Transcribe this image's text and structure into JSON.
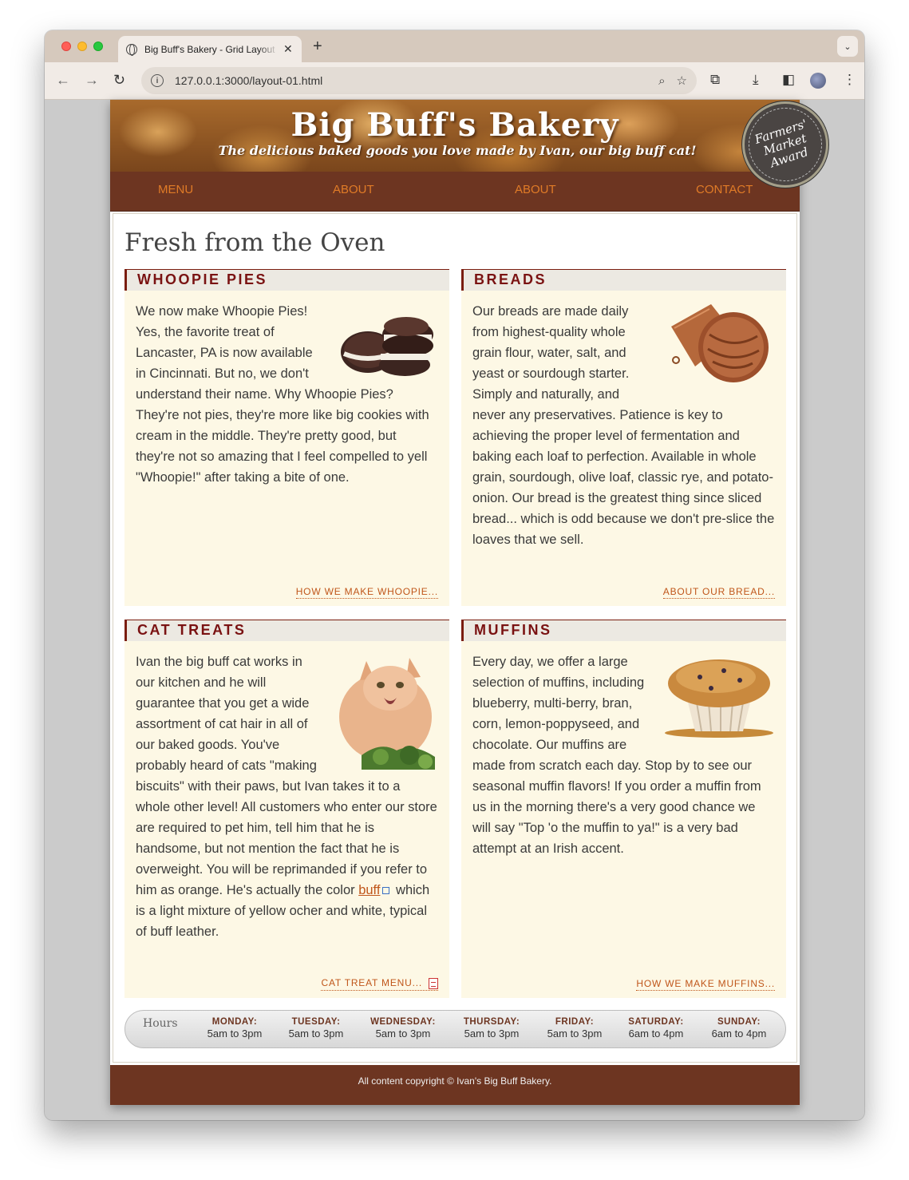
{
  "browser": {
    "tab_title": "Big Buff's Bakery - Grid Layout",
    "url": "127.0.0.1:3000/layout-01.html"
  },
  "site": {
    "title": "Big Buff's Bakery",
    "tagline": "The delicious baked goods you love made by Ivan, our big buff cat!",
    "award": [
      "Farmers'",
      "Market",
      "Award"
    ]
  },
  "nav": [
    "MENU",
    "ABOUT",
    "ABOUT",
    "CONTACT"
  ],
  "main": {
    "heading": "Fresh from the Oven",
    "cards": [
      {
        "title": "WHOOPIE PIES",
        "image": "whoopie-pies-image",
        "text": "We now make Whoopie Pies! Yes, the favorite treat of Lancaster, PA is now available in Cincinnati. But no, we don't understand their name. Why Whoopie Pies? They're not pies, they're more like big cookies with cream in the middle. They're pretty good, but they're not so amazing that I feel compelled to yell \"Whoopie!\" after taking a bite of one.",
        "link": "HOW WE MAKE WHOOPIE..."
      },
      {
        "title": "BREADS",
        "image": "bread-image",
        "text": "Our breads are made daily from highest-quality whole grain flour, water, salt, and yeast or sourdough starter. Simply and naturally, and never any preservatives. Patience is key to achieving the proper level of fermentation and baking each loaf to perfection. Available in whole grain, sourdough, olive loaf, classic rye, and potato-onion. Our bread is the greatest thing since sliced bread... which is odd because we don't pre-slice the loaves that we sell.",
        "link": "ABOUT OUR BREAD..."
      },
      {
        "title": "CAT TREATS",
        "image": "cat-image",
        "text_before": "Ivan the big buff cat works in our kitchen and he will guarantee that you get a wide assortment of cat hair in all of our baked goods. You've probably heard of cats \"making biscuits\" with their paws, but Ivan takes it to a whole other level! All customers who enter our store are required to pet him, tell him that he is handsome, but not mention the fact that he is overweight. You will be reprimanded if you refer to him as orange. He's actually the color ",
        "inline_link": "buff",
        "text_after": " which is a light mixture of yellow ocher and white, typical of buff leather.",
        "link": "CAT TREAT MENU..."
      },
      {
        "title": "MUFFINS",
        "image": "muffin-image",
        "text": "Every day, we offer a large selection of muffins, including blueberry, multi-berry, bran, corn, lemon-poppyseed, and chocolate. Our muffins are made from scratch each day. Stop by to see our seasonal muffin flavors! If you order a muffin from us in the morning there's a very good chance we will say \"Top 'o the muffin to ya!\" is a very bad attempt at an Irish accent.",
        "link": "HOW WE MAKE MUFFINS..."
      }
    ]
  },
  "hours": {
    "label": "Hours",
    "days": [
      {
        "name": "MONDAY:",
        "time": "5am to 3pm"
      },
      {
        "name": "TUESDAY:",
        "time": "5am to 3pm"
      },
      {
        "name": "WEDNESDAY:",
        "time": "5am to 3pm"
      },
      {
        "name": "THURSDAY:",
        "time": "5am to 3pm"
      },
      {
        "name": "FRIDAY:",
        "time": "5am to 3pm"
      },
      {
        "name": "SATURDAY:",
        "time": "6am to 4pm"
      },
      {
        "name": "SUNDAY:",
        "time": "6am to 4pm"
      }
    ]
  },
  "footer": "All content copyright © Ivan's Big Buff Bakery.",
  "colors": {
    "nav_bg": "#6d3521",
    "link": "#e07b27",
    "card_bg": "#fdf8e5",
    "card_title": "#7a1212"
  }
}
